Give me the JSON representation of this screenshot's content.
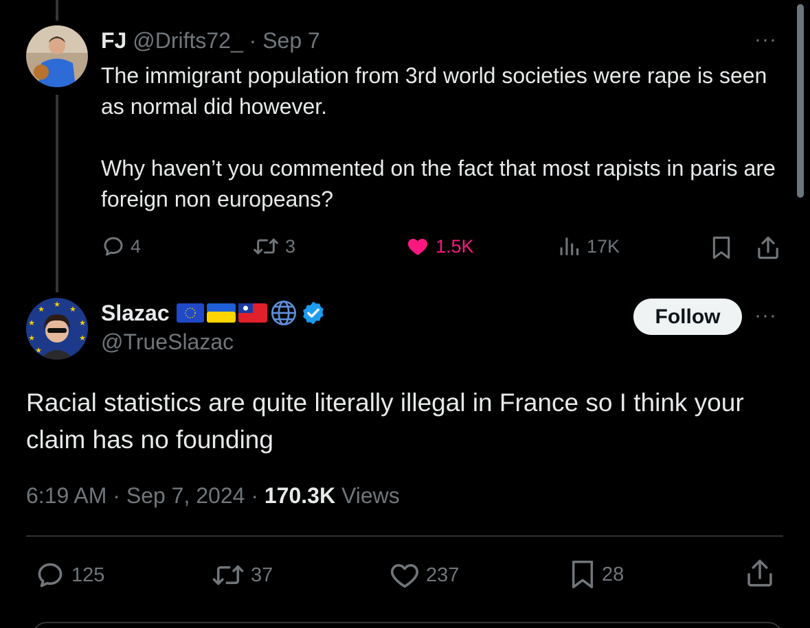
{
  "reply_tweet": {
    "author_name": "FJ",
    "author_handle": "@Drifts72_",
    "separator": "·",
    "date": "Sep 7",
    "text": "The immigrant population from 3rd world societies were rape is seen as normal did however.\n\nWhy haven’t you commented on the fact that most rapists in paris are foreign non europeans?",
    "more_label": "···",
    "actions": {
      "replies": "4",
      "reposts": "3",
      "likes": "1.5K",
      "views": "17K"
    },
    "liked": true,
    "like_color": "#f91880"
  },
  "main_tweet": {
    "author_name": "Slazac",
    "author_handle": "@TrueSlazac",
    "verified": true,
    "verified_color": "#1d9bf0",
    "name_badges": [
      "eu-flag-icon",
      "ukraine-flag-icon",
      "taiwan-flag-icon",
      "globe-icon"
    ],
    "follow_label": "Follow",
    "more_label": "···",
    "text": "Racial statistics are quite literally illegal in France so I think your claim has no founding",
    "time": "6:19 AM",
    "date": "Sep 7, 2024",
    "separator": "·",
    "views_count": "170.3K",
    "views_label": "Views",
    "actions": {
      "replies": "125",
      "reposts": "37",
      "likes": "237",
      "bookmarks": "28"
    }
  },
  "colors": {
    "background": "#000000",
    "text": "#e7e9ea",
    "muted": "#71767b",
    "divider": "#2f3336"
  }
}
